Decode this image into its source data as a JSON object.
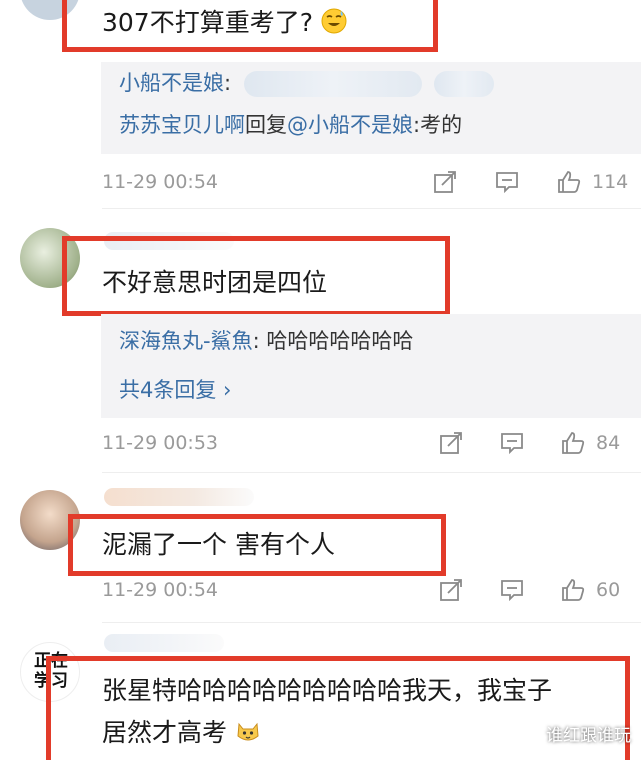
{
  "comments": [
    {
      "text": "307不打算重考了?",
      "emoji": "grinning-sweat-emoji",
      "reply": {
        "line1_user": "小船不是娘",
        "line1_colon": ":",
        "line2_user": "苏苏宝贝儿啊",
        "line2_action": "回复",
        "line2_mention": "@小船不是娘",
        "line2_text": ":考的"
      },
      "time": "11-29 00:54",
      "likes": "114"
    },
    {
      "text": "不好意思时团是四位",
      "reply": {
        "user": "深海魚丸-鯊魚",
        "text": ": 哈哈哈哈哈哈哈",
        "more": "共4条回复 ›"
      },
      "time": "11-29 00:53",
      "likes": "84"
    },
    {
      "text": "泥漏了一个 害有个人",
      "time": "11-29 00:54",
      "likes": "60"
    },
    {
      "avatar_text_top": "正在",
      "avatar_text_bottom": "学习",
      "text_line1": "张星特哈哈哈哈哈哈哈哈哈我天，我宝子",
      "text_line2": "居然才高考",
      "emoji": "cat-emoji"
    }
  ],
  "watermark": "谁红跟谁玩",
  "colors": {
    "highlight": "#e23b2a",
    "link": "#3a6ea5",
    "meta": "#9a9a9a",
    "reply_bg": "#f3f3f5"
  }
}
